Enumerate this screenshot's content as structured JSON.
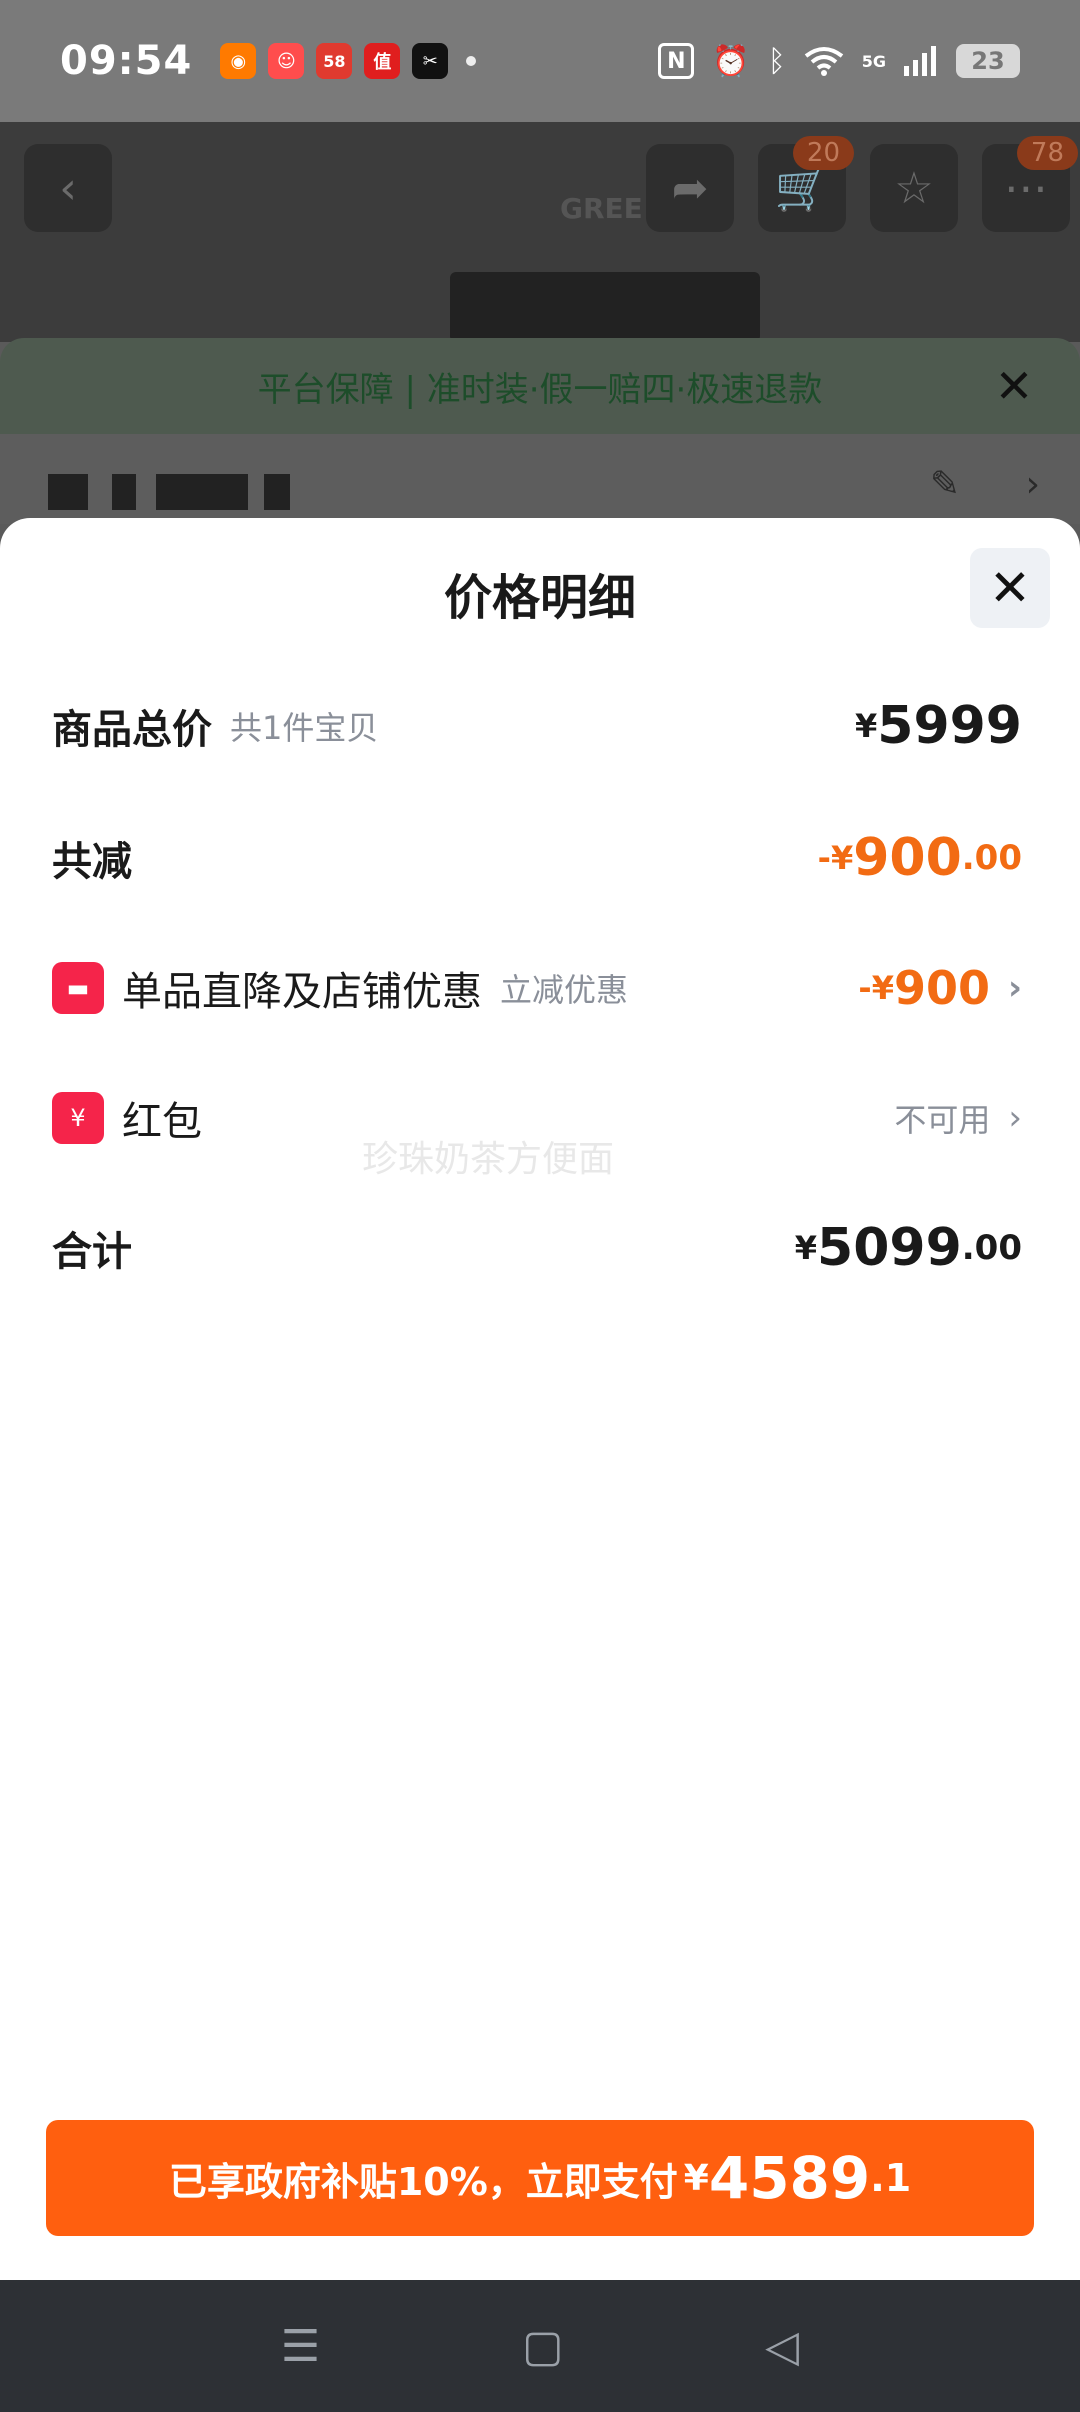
{
  "status_bar": {
    "time": "09:54",
    "apps": [
      {
        "icon": "app-orange-icon",
        "glyph": "◉",
        "color": "#ff7a00"
      },
      {
        "icon": "app-mascot-icon",
        "glyph": "☺",
        "color": "#ff4d4d"
      },
      {
        "icon": "app-58-icon",
        "glyph": "58",
        "color": "#e03a2f"
      },
      {
        "icon": "app-zhi-icon",
        "glyph": "值",
        "color": "#e01e1e"
      },
      {
        "icon": "app-capcut-icon",
        "glyph": "✂",
        "color": "#111111"
      }
    ],
    "network": "5G",
    "battery": "23"
  },
  "background": {
    "cart_badge": "20",
    "msg_badge": "78",
    "guarantee_text": "平台保障 | 准时装·假一赔四·极速退款"
  },
  "sheet": {
    "title": "价格明细",
    "rows": {
      "total": {
        "label": "商品总价",
        "sub": "共1件宝贝",
        "currency": "¥",
        "amount": "5999"
      },
      "discount": {
        "label": "共减",
        "prefix": "-¥",
        "amount": "900",
        "decimal": ".00"
      },
      "shop_discount": {
        "label": "单品直降及店铺优惠",
        "sub": "立减优惠",
        "prefix": "-¥",
        "amount": "900"
      },
      "red_packet": {
        "label": "红包",
        "status": "不可用"
      },
      "sum": {
        "label": "合计",
        "currency": "¥",
        "amount": "5099",
        "decimal": ".00"
      }
    },
    "watermark": "珍珠奶茶方便面",
    "pay_button": {
      "text": "已享政府补贴10%，立即支付",
      "currency": "¥",
      "amount": "4589",
      "decimal": ".1"
    }
  },
  "colors": {
    "accent": "#ff5f0f",
    "discount": "#f26b13",
    "badge": "#f5244a"
  }
}
